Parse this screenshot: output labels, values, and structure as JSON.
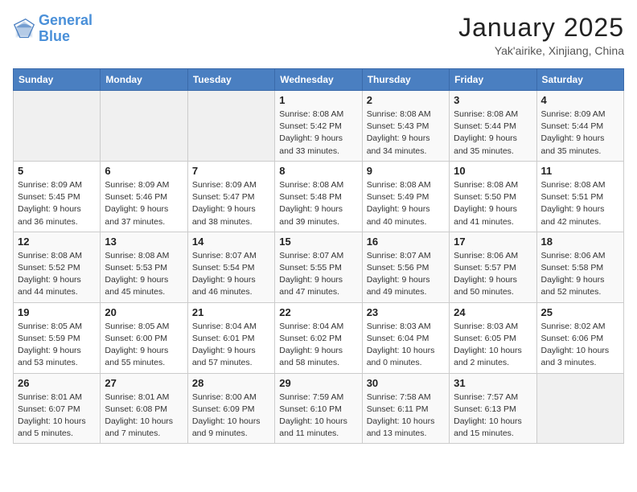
{
  "header": {
    "logo_line1": "General",
    "logo_line2": "Blue",
    "month": "January 2025",
    "location": "Yak'airike, Xinjiang, China"
  },
  "weekdays": [
    "Sunday",
    "Monday",
    "Tuesday",
    "Wednesday",
    "Thursday",
    "Friday",
    "Saturday"
  ],
  "weeks": [
    [
      {
        "day": "",
        "info": ""
      },
      {
        "day": "",
        "info": ""
      },
      {
        "day": "",
        "info": ""
      },
      {
        "day": "1",
        "info": "Sunrise: 8:08 AM\nSunset: 5:42 PM\nDaylight: 9 hours and 33 minutes."
      },
      {
        "day": "2",
        "info": "Sunrise: 8:08 AM\nSunset: 5:43 PM\nDaylight: 9 hours and 34 minutes."
      },
      {
        "day": "3",
        "info": "Sunrise: 8:08 AM\nSunset: 5:44 PM\nDaylight: 9 hours and 35 minutes."
      },
      {
        "day": "4",
        "info": "Sunrise: 8:09 AM\nSunset: 5:44 PM\nDaylight: 9 hours and 35 minutes."
      }
    ],
    [
      {
        "day": "5",
        "info": "Sunrise: 8:09 AM\nSunset: 5:45 PM\nDaylight: 9 hours and 36 minutes."
      },
      {
        "day": "6",
        "info": "Sunrise: 8:09 AM\nSunset: 5:46 PM\nDaylight: 9 hours and 37 minutes."
      },
      {
        "day": "7",
        "info": "Sunrise: 8:09 AM\nSunset: 5:47 PM\nDaylight: 9 hours and 38 minutes."
      },
      {
        "day": "8",
        "info": "Sunrise: 8:08 AM\nSunset: 5:48 PM\nDaylight: 9 hours and 39 minutes."
      },
      {
        "day": "9",
        "info": "Sunrise: 8:08 AM\nSunset: 5:49 PM\nDaylight: 9 hours and 40 minutes."
      },
      {
        "day": "10",
        "info": "Sunrise: 8:08 AM\nSunset: 5:50 PM\nDaylight: 9 hours and 41 minutes."
      },
      {
        "day": "11",
        "info": "Sunrise: 8:08 AM\nSunset: 5:51 PM\nDaylight: 9 hours and 42 minutes."
      }
    ],
    [
      {
        "day": "12",
        "info": "Sunrise: 8:08 AM\nSunset: 5:52 PM\nDaylight: 9 hours and 44 minutes."
      },
      {
        "day": "13",
        "info": "Sunrise: 8:08 AM\nSunset: 5:53 PM\nDaylight: 9 hours and 45 minutes."
      },
      {
        "day": "14",
        "info": "Sunrise: 8:07 AM\nSunset: 5:54 PM\nDaylight: 9 hours and 46 minutes."
      },
      {
        "day": "15",
        "info": "Sunrise: 8:07 AM\nSunset: 5:55 PM\nDaylight: 9 hours and 47 minutes."
      },
      {
        "day": "16",
        "info": "Sunrise: 8:07 AM\nSunset: 5:56 PM\nDaylight: 9 hours and 49 minutes."
      },
      {
        "day": "17",
        "info": "Sunrise: 8:06 AM\nSunset: 5:57 PM\nDaylight: 9 hours and 50 minutes."
      },
      {
        "day": "18",
        "info": "Sunrise: 8:06 AM\nSunset: 5:58 PM\nDaylight: 9 hours and 52 minutes."
      }
    ],
    [
      {
        "day": "19",
        "info": "Sunrise: 8:05 AM\nSunset: 5:59 PM\nDaylight: 9 hours and 53 minutes."
      },
      {
        "day": "20",
        "info": "Sunrise: 8:05 AM\nSunset: 6:00 PM\nDaylight: 9 hours and 55 minutes."
      },
      {
        "day": "21",
        "info": "Sunrise: 8:04 AM\nSunset: 6:01 PM\nDaylight: 9 hours and 57 minutes."
      },
      {
        "day": "22",
        "info": "Sunrise: 8:04 AM\nSunset: 6:02 PM\nDaylight: 9 hours and 58 minutes."
      },
      {
        "day": "23",
        "info": "Sunrise: 8:03 AM\nSunset: 6:04 PM\nDaylight: 10 hours and 0 minutes."
      },
      {
        "day": "24",
        "info": "Sunrise: 8:03 AM\nSunset: 6:05 PM\nDaylight: 10 hours and 2 minutes."
      },
      {
        "day": "25",
        "info": "Sunrise: 8:02 AM\nSunset: 6:06 PM\nDaylight: 10 hours and 3 minutes."
      }
    ],
    [
      {
        "day": "26",
        "info": "Sunrise: 8:01 AM\nSunset: 6:07 PM\nDaylight: 10 hours and 5 minutes."
      },
      {
        "day": "27",
        "info": "Sunrise: 8:01 AM\nSunset: 6:08 PM\nDaylight: 10 hours and 7 minutes."
      },
      {
        "day": "28",
        "info": "Sunrise: 8:00 AM\nSunset: 6:09 PM\nDaylight: 10 hours and 9 minutes."
      },
      {
        "day": "29",
        "info": "Sunrise: 7:59 AM\nSunset: 6:10 PM\nDaylight: 10 hours and 11 minutes."
      },
      {
        "day": "30",
        "info": "Sunrise: 7:58 AM\nSunset: 6:11 PM\nDaylight: 10 hours and 13 minutes."
      },
      {
        "day": "31",
        "info": "Sunrise: 7:57 AM\nSunset: 6:13 PM\nDaylight: 10 hours and 15 minutes."
      },
      {
        "day": "",
        "info": ""
      }
    ]
  ]
}
